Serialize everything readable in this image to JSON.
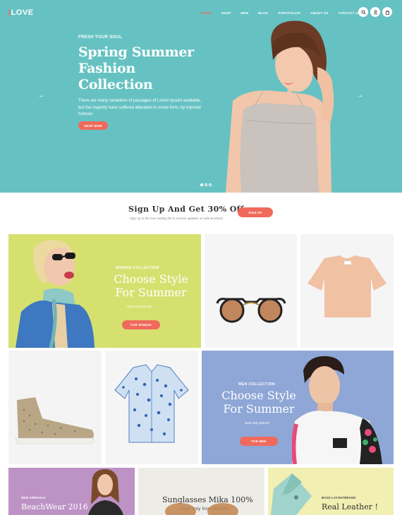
{
  "header": {
    "logo_mark": "|",
    "logo_text": "LOVE",
    "nav": [
      "HOME",
      "SHOP",
      "MEN",
      "BLOG",
      "PORTFOLIOS",
      "ABOUT US",
      "CONTACT US"
    ],
    "icons": [
      "search-icon",
      "user-icon",
      "bag-icon"
    ]
  },
  "hero": {
    "kicker": "FRESH YOUR SOUL",
    "title_line1": "Spring Summer",
    "title_line2": "Fashion Collection",
    "text": "There are many variations of passages of Lorem Ipsum available, but the majority have suffered alteration in some form, by injected humour",
    "button": "SHOP NOW",
    "prev": "←",
    "next": "→",
    "slides": 3,
    "active_slide": 1
  },
  "signup": {
    "title": "Sign Up And Get 30% Off",
    "subtitle": "Sign up to the love mailing list to receive updates on sale products",
    "button": "SIGN UP"
  },
  "woman_collection": {
    "kicker": "WOMAN COLLECTION",
    "title_line1": "Choose Style",
    "title_line2": "For Summer",
    "price": "Start only $49.00",
    "button": "FOR WOMAN"
  },
  "men_collection": {
    "kicker": "MEN COLLECTION",
    "title_line1": "Choose Style",
    "title_line2": "For Summer",
    "price": "Start only $49.00",
    "button": "FOR MEN"
  },
  "beachwear": {
    "kicker": "NEW ARRIVALS",
    "title": "BeachWear 2016"
  },
  "sunglasses": {
    "title": "Sunglasses Mika 100%",
    "price": "Start only from $49.00"
  },
  "leather": {
    "kicker": "BAGS LAYOUTBRAND",
    "title": "Real Leather !"
  },
  "colors": {
    "hero_bg": "#66c2c2",
    "accent": "#f06a5c",
    "woman_bg": "#d6e06f",
    "men_bg": "#8fa7d6",
    "beach_bg": "#bd92c5",
    "leather_bg": "#f1efb2"
  }
}
